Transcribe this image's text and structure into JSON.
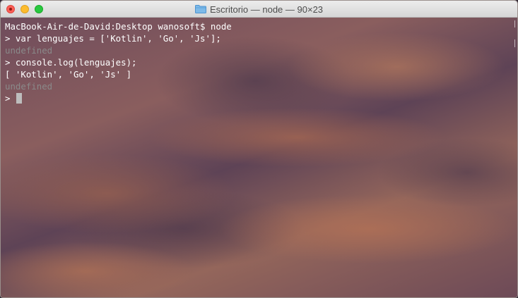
{
  "window": {
    "title": "Escritorio — node — 90×23"
  },
  "terminal": {
    "lines": [
      {
        "text": "MacBook-Air-de-David:Desktop wanosoft$ node",
        "style": "normal"
      },
      {
        "text": "> var lenguajes = ['Kotlin', 'Go', 'Js'];",
        "style": "normal"
      },
      {
        "text": "undefined",
        "style": "dim"
      },
      {
        "text": "> console.log(lenguajes);",
        "style": "normal"
      },
      {
        "text": "[ 'Kotlin', 'Go', 'Js' ]",
        "style": "normal"
      },
      {
        "text": "undefined",
        "style": "dim"
      }
    ],
    "prompt": "> "
  },
  "colors": {
    "text": "#ffffff",
    "dim_text": "#8a8a8a",
    "cursor": "#bdbdbd",
    "close": "#fc5f57",
    "minimize": "#fdbc2e",
    "zoom": "#28c840"
  }
}
